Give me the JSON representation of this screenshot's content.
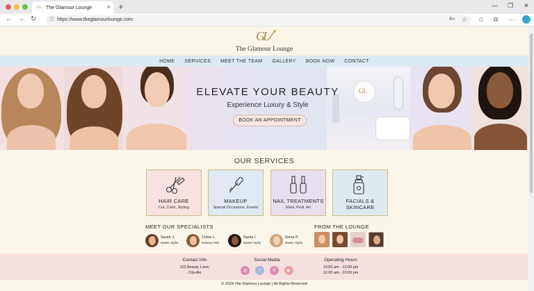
{
  "browser": {
    "tab_title": "The Glamour Lounge",
    "tab_favicon": "GL",
    "url": "https://www.theglamourlounge.com"
  },
  "site": {
    "logo_mark": "GL",
    "name": "The Glamour Lounge",
    "nav": [
      "HOME",
      "SERVICES",
      "MEET THE TEAM",
      "GALLERY",
      "BOOK NOW",
      "CONTACT"
    ]
  },
  "hero": {
    "title": "ELEVATE YOUR BEAUTY",
    "subtitle": "Experience Luxury & Style",
    "cta": "BOOK AN APPOINTMENT"
  },
  "services": {
    "title": "OUR SERVICES",
    "items": [
      {
        "title": "HAIR CARE",
        "subtitle": "Cut, Color, Styling",
        "icon": "scissors-comb-icon",
        "bg": "#f9e1e1"
      },
      {
        "title": "MAKEUP",
        "subtitle": "Special Occasions, Events",
        "icon": "mascara-icon",
        "bg": "#dfeaf3"
      },
      {
        "title": "NAIL TREATMENTS",
        "subtitle": "Mani, Pedi, Art",
        "icon": "nail-polish-icon",
        "bg": "#e8e0ef"
      },
      {
        "title": "FACIALS &\nSKINCARE",
        "subtitle": "",
        "icon": "skincare-bottle-icon",
        "bg": "#dfeaf0"
      }
    ]
  },
  "specialists": {
    "title": "MEET OUR SPECIALISTS",
    "items": [
      {
        "name": "Sarah J.",
        "role": "Master Stylist"
      },
      {
        "name": "Chloe L.",
        "role": "Makeup Artist"
      },
      {
        "name": "Sania I.",
        "role": "Master Stylist"
      },
      {
        "name": "Gena P.",
        "role": "Master Stylist"
      }
    ]
  },
  "gallery": {
    "title": "FROM THE LOUNGE"
  },
  "footer": {
    "contact_title": "Contact Info",
    "contact_line1": "123 Beauty Lane,",
    "contact_line2": "Cityville",
    "social_title": "Social Media",
    "social_icons": [
      "instagram-icon",
      "facebook-icon",
      "pinterest-icon",
      "youtube-icon"
    ],
    "hours_title": "Operating Hours",
    "hours_line1": "10:00 am - 12:00 pm",
    "hours_line2": "12:00 am - 10:00 pm",
    "copyright": "© 2024 The Glamour Lounge | All Rights Reserved"
  },
  "colors": {
    "accent_gold": "#b08a4a",
    "nav_bg": "#dceaf2",
    "footer_bg": "#f7dfe0",
    "page_bg": "#fbf6ea"
  }
}
